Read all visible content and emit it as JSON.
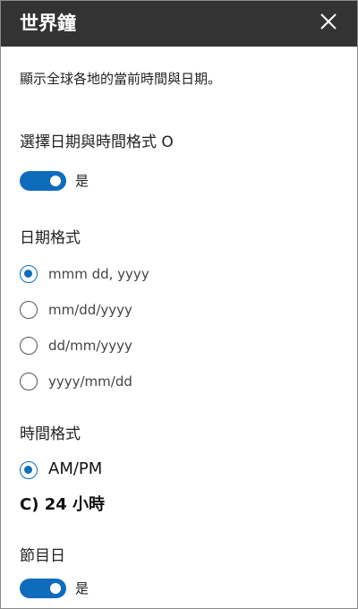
{
  "header": {
    "title": "世界鐘",
    "close_icon": "close-icon"
  },
  "description": "顯示全球各地的當前時間與日期。",
  "date_time_format_section": {
    "label": "選擇日期與時間格式 O",
    "toggle": {
      "on": true,
      "text": "是"
    }
  },
  "date_format": {
    "label": "日期格式",
    "options": [
      {
        "label": "mmm dd, yyyy",
        "checked": true
      },
      {
        "label": "mm/dd/yyyy",
        "checked": false
      },
      {
        "label": "dd/mm/yyyy",
        "checked": false
      },
      {
        "label": "yyyy/mm/dd",
        "checked": false
      }
    ]
  },
  "time_format": {
    "label": "時間格式",
    "options": [
      {
        "label": "AM/PM",
        "checked": true
      }
    ],
    "other_option_text": "C) 24 小時"
  },
  "holiday": {
    "label": "節目日",
    "toggle": {
      "on": true,
      "text": "是"
    }
  },
  "colors": {
    "accent": "#0f6cbd",
    "header_bg": "#333333"
  }
}
